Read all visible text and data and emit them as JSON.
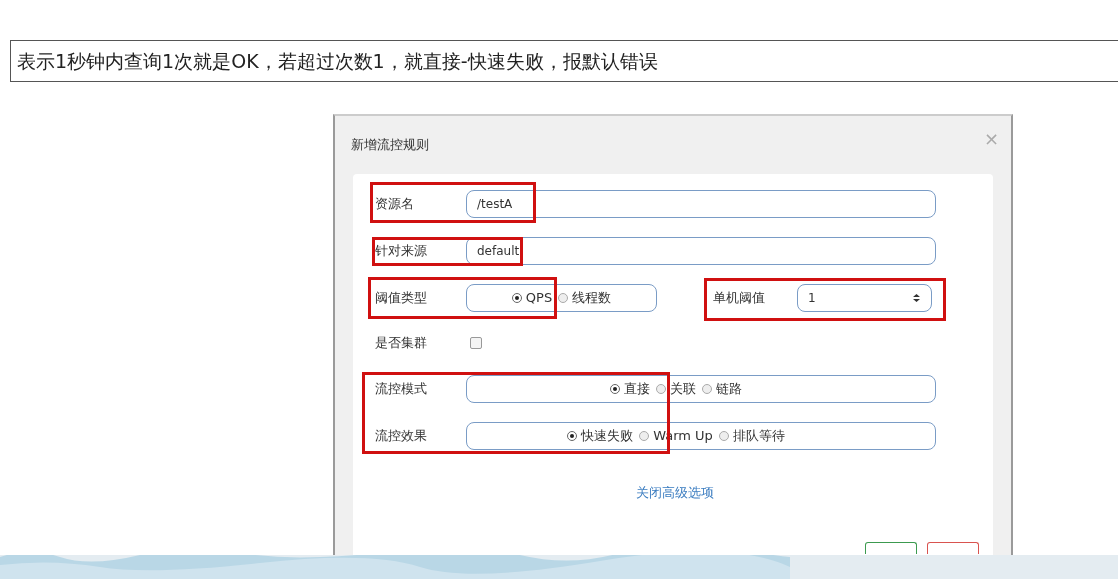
{
  "annotation": "表示1秒钟内查询1次就是OK，若超过次数1，就直接-快速失败，报默认错误",
  "dialog": {
    "title": "新增流控规则",
    "close": "×",
    "fields": [
      {
        "kind": "text",
        "label": "资源名",
        "value": "/testA"
      },
      {
        "kind": "text",
        "label": "针对来源",
        "value": "default"
      },
      {
        "kind": "split",
        "label": "阈值类型",
        "options": [
          {
            "label": "QPS",
            "selected": true
          },
          {
            "label": "线程数",
            "selected": false
          }
        ],
        "side_label": "单机阈值",
        "side_value": "1"
      },
      {
        "kind": "checkbox",
        "label": "是否集群",
        "checked": false
      },
      {
        "kind": "radio",
        "label": "流控模式",
        "options": [
          {
            "label": "直接",
            "selected": true
          },
          {
            "label": "关联",
            "selected": false
          },
          {
            "label": "链路",
            "selected": false
          }
        ]
      },
      {
        "kind": "radio",
        "label": "流控效果",
        "options": [
          {
            "label": "快速失败",
            "selected": true
          },
          {
            "label": "Warm Up",
            "selected": false
          },
          {
            "label": "排队等待",
            "selected": false
          }
        ]
      }
    ],
    "link": "关闭高级选项"
  }
}
